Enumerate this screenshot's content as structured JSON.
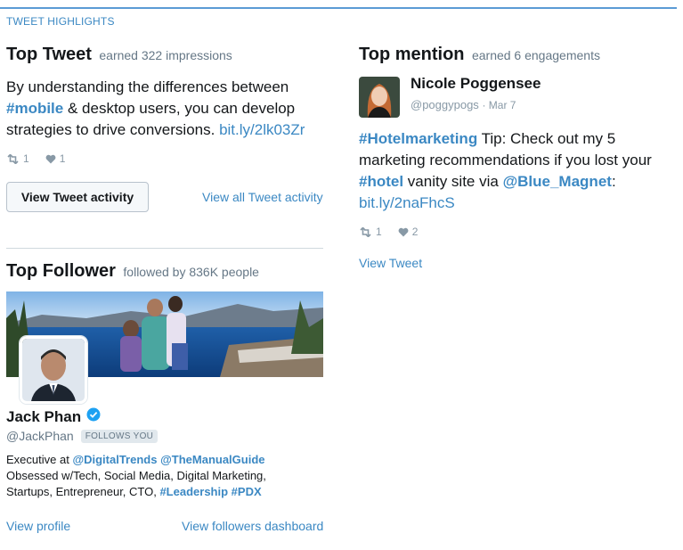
{
  "section_label": "TWEET HIGHLIGHTS",
  "top_tweet": {
    "title": "Top Tweet",
    "subtitle": "earned 322 impressions",
    "text_line1": "By understanding the differences between",
    "text_hashtag": "#mobile",
    "text_line2_rest": " & desktop users, you can develop",
    "text_line3": "strategies to drive conversions. ",
    "text_link": "bit.ly/2lk03Zr",
    "retweets": "1",
    "likes": "1",
    "view_activity_button": "View Tweet activity",
    "view_all_link": "View all Tweet activity"
  },
  "top_follower": {
    "title": "Top Follower",
    "subtitle": "followed by 836K people",
    "name": "Jack Phan",
    "handle": "@JackPhan",
    "follows_badge": "FOLLOWS YOU",
    "bio_prefix": "Executive at ",
    "bio_mention1": "@DigitalTrends",
    "bio_space": " ",
    "bio_mention2": "@TheManualGuide",
    "bio_line2": "Obsessed w/Tech, Social Media, Digital Marketing,",
    "bio_line3_prefix": "Startups, Entrepreneur, CTO, ",
    "bio_hashtag1": "#Leadership",
    "bio_hashtag2": "#PDX",
    "view_profile_link": "View profile",
    "view_dashboard_link": "View followers dashboard"
  },
  "top_mention": {
    "title": "Top mention",
    "subtitle": "earned 6 engagements",
    "name": "Nicole Poggensee",
    "handle": "@poggypogs",
    "date": "· Mar 7",
    "hashtag1": "#Hotelmarketing",
    "line1_rest": " Tip: Check out my 5",
    "line2": "marketing recommendations if you lost your",
    "hashtag2": "#hotel",
    "line3_mid": " vanity site via ",
    "mention": "@Blue_Magnet",
    "colon": ":",
    "link": "bit.ly/2naFhcS",
    "retweets": "1",
    "likes": "2",
    "view_tweet_link": "View Tweet"
  },
  "colors": {
    "accent": "#3b88c3",
    "verified": "#1da1f2",
    "top_rule": "#5b9bd5"
  },
  "icons": [
    "retweet-icon",
    "heart-icon",
    "verified-badge-icon"
  ]
}
